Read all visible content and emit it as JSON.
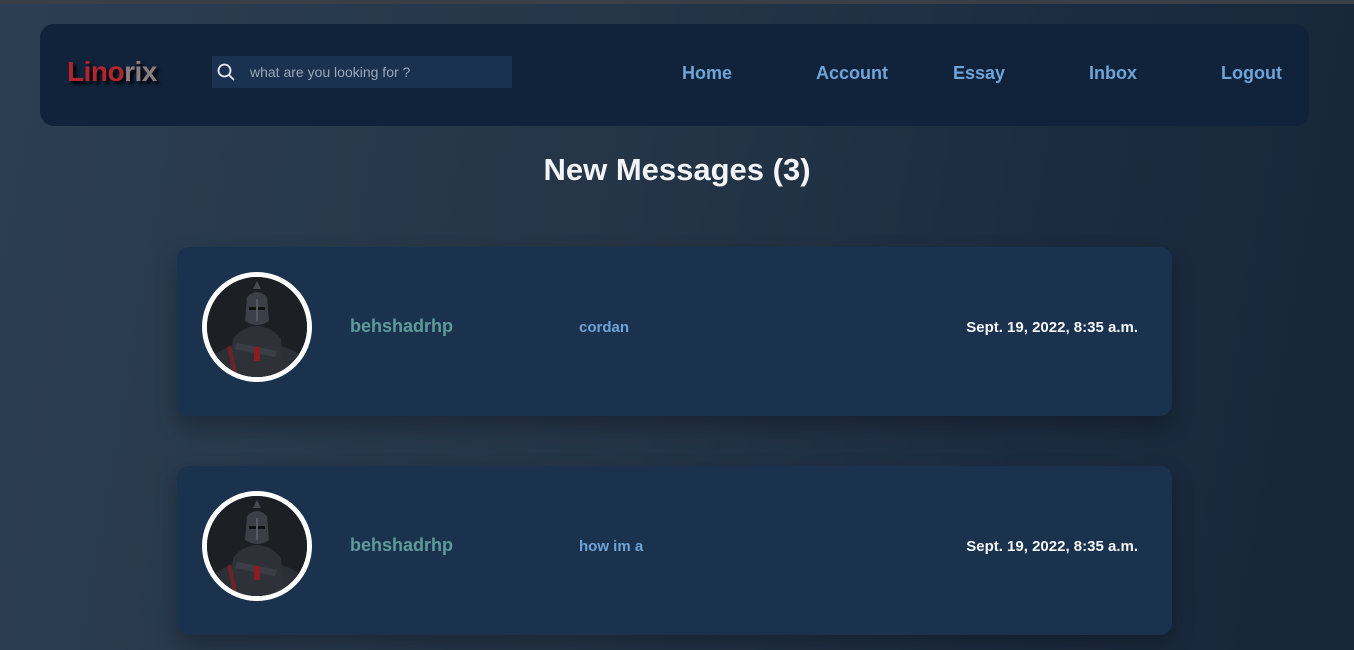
{
  "app": {
    "logo_part1": "Lino",
    "logo_part2": "rix"
  },
  "search": {
    "placeholder": "what are you looking for ?",
    "icon": "search-icon"
  },
  "nav": {
    "home": "Home",
    "account": "Account",
    "essay": "Essay",
    "inbox": "Inbox",
    "logout": "Logout"
  },
  "page": {
    "title": "New Messages (3)"
  },
  "messages": [
    {
      "sender": "behshadrhp",
      "subject": "cordan",
      "timestamp": "Sept. 19, 2022, 8:35 a.m.",
      "avatar": "knight-avatar"
    },
    {
      "sender": "behshadrhp",
      "subject": "how im a",
      "timestamp": "Sept. 19, 2022, 8:35 a.m.",
      "avatar": "knight-avatar"
    }
  ],
  "colors": {
    "navbar_bg": "#11233a",
    "card_bg": "#1b324e",
    "logo_red": "#b0262e",
    "link_blue": "#6fa4d8",
    "sender_teal": "#5e9c9a"
  }
}
